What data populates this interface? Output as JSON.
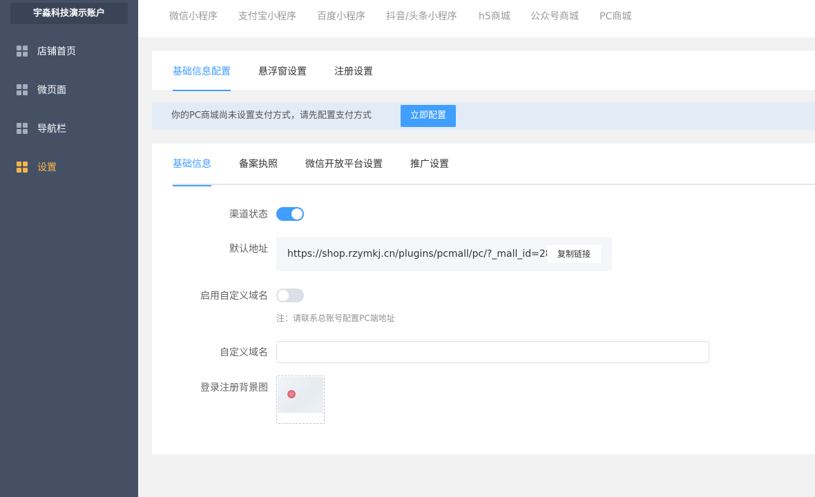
{
  "sidebar": {
    "account": "宇淼科技演示账户",
    "items": [
      {
        "label": "店铺首页"
      },
      {
        "label": "微页面"
      },
      {
        "label": "导航栏"
      },
      {
        "label": "设置",
        "active": true
      }
    ]
  },
  "top_tabs": [
    "微信小程序",
    "支付宝小程序",
    "百度小程序",
    "抖音/头条小程序",
    "h5商城",
    "公众号商城",
    "PC商城"
  ],
  "settings_tabs": {
    "items": [
      "基础信息配置",
      "悬浮窗设置",
      "注册设置"
    ],
    "active": "基础信息配置"
  },
  "notice": {
    "text": "你的PC商城尚未设置支付方式，请先配置支付方式",
    "button": "立即配置"
  },
  "form_tabs": {
    "items": [
      "基础信息",
      "备案执照",
      "微信开放平台设置",
      "推广设置"
    ],
    "active": "基础信息"
  },
  "form": {
    "channel_status_label": "渠道状态",
    "channel_status": true,
    "default_address_label": "默认地址",
    "default_address": "https://shop.rzymkj.cn/plugins/pcmall/pc/?_mall_id=28",
    "copy_button": "复制链接",
    "custom_domain_toggle_label": "启用自定义域名",
    "custom_domain_enabled": false,
    "note": "注：请联系总账号配置PC端地址",
    "custom_domain_label": "自定义域名",
    "custom_domain_value": "",
    "login_bg_label": "登录注册背景图"
  },
  "colors": {
    "sidebar": "#455065",
    "accent": "#409eff",
    "active_nav": "#f5b54a"
  }
}
